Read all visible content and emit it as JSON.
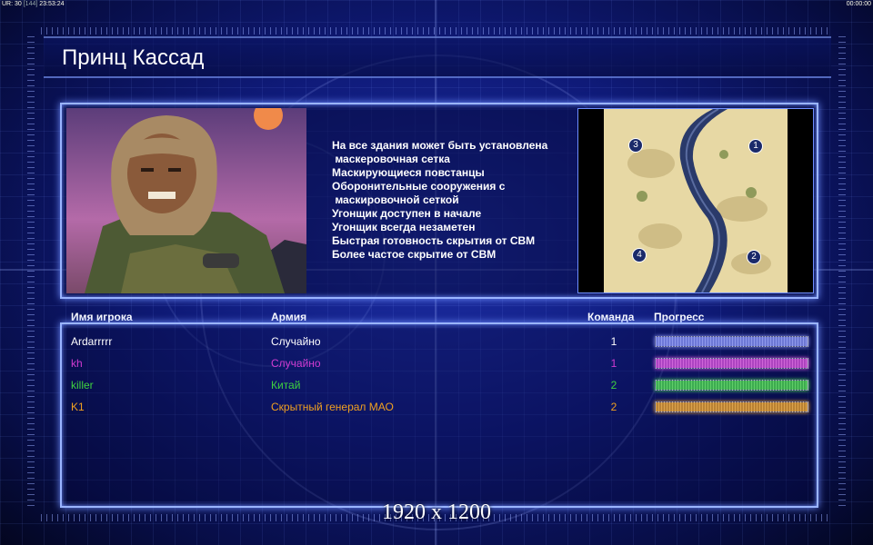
{
  "hud": {
    "top_left": "UR: 30 ",
    "top_left_mid": "[144]",
    "top_left_time": "23:53:24",
    "top_right": "00:00:00"
  },
  "title": "Принц Кассад",
  "features": [
    "На все здания может быть установлена",
    " маскеровочная сетка",
    "Маскирующиеся повстанцы",
    "Оборонительные сооружения с",
    " маскировочной сеткой",
    "Угонщик доступен в начале",
    "Угонщик всегда незаметен",
    "Быстрая готовность скрытия от СВМ",
    "Более частое скрытие от СВМ"
  ],
  "minimap": {
    "markers": [
      {
        "label": "3"
      },
      {
        "label": "1"
      },
      {
        "label": "4"
      },
      {
        "label": "2"
      }
    ]
  },
  "columns": {
    "name": "Имя игрока",
    "army": "Армия",
    "team": "Команда",
    "progress": "Прогресс"
  },
  "players": [
    {
      "name": "Ardarrrrr",
      "army": "Случайно",
      "team": "1",
      "color": "#ffffff",
      "bar_color": "#8f9bff",
      "progress": 1.0
    },
    {
      "name": "kh",
      "army": "Случайно",
      "team": "1",
      "color": "#d13bd1",
      "bar_color": "#e455e4",
      "progress": 1.0
    },
    {
      "name": "killer",
      "army": "Китай",
      "team": "2",
      "color": "#3fd23f",
      "bar_color": "#4fe04f",
      "progress": 1.0
    },
    {
      "name": "K1",
      "army": "Скрытный генерал МАО",
      "team": "2",
      "color": "#f0a020",
      "bar_color": "#f5a82a",
      "progress": 1.0
    }
  ],
  "resolution": "1920 x 1200"
}
